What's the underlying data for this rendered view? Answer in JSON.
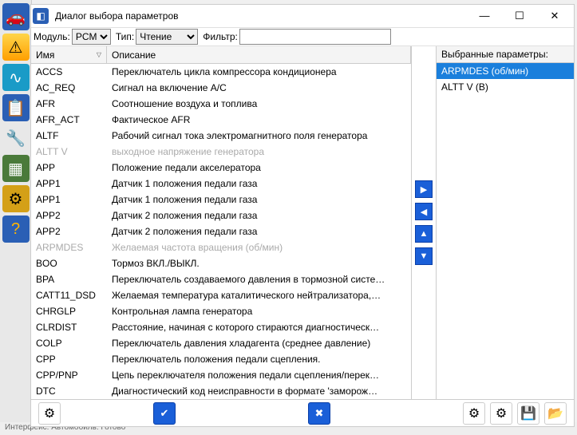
{
  "window": {
    "title": "Диалог выбора параметров",
    "min": "—",
    "max": "☐",
    "close": "✕"
  },
  "toolbar": {
    "module_label": "Модуль:",
    "module_value": "PCM",
    "type_label": "Тип:",
    "type_value": "Чтение",
    "filter_label": "Фильтр:",
    "filter_value": ""
  },
  "columns": {
    "name": "Имя",
    "desc": "Описание"
  },
  "rows": [
    {
      "name": "ACCS",
      "desc": "Переключатель цикла компрессора кондиционера",
      "disabled": false
    },
    {
      "name": "AC_REQ",
      "desc": "Сигнал на включение A/C",
      "disabled": false
    },
    {
      "name": "AFR",
      "desc": "Соотношение воздуха и топлива",
      "disabled": false
    },
    {
      "name": "AFR_ACT",
      "desc": "Фактическое AFR",
      "disabled": false
    },
    {
      "name": "ALTF",
      "desc": "Рабочий сигнал тока электромагнитного поля генератора",
      "disabled": false
    },
    {
      "name": "ALTT V",
      "desc": "выходное напряжение генератора",
      "disabled": true
    },
    {
      "name": "APP",
      "desc": "Положение педали акселератора",
      "disabled": false
    },
    {
      "name": "APP1",
      "desc": "Датчик 1 положения педали газа",
      "disabled": false
    },
    {
      "name": "APP1",
      "desc": "Датчик 1 положения педали газа",
      "disabled": false
    },
    {
      "name": "APP2",
      "desc": "Датчик 2 положения педали газа",
      "disabled": false
    },
    {
      "name": "APP2",
      "desc": "Датчик 2 положения педали газа",
      "disabled": false
    },
    {
      "name": "ARPMDES",
      "desc": "Желаемая частота вращения (об/мин)",
      "disabled": true
    },
    {
      "name": "BOO",
      "desc": "Тормоз ВКЛ./ВЫКЛ.",
      "disabled": false
    },
    {
      "name": "BPA",
      "desc": "Переключатель создаваемого давления в тормозной систе…",
      "disabled": false
    },
    {
      "name": "CATT11_DSD",
      "desc": "Желаемая температура каталитического нейтрализатора,…",
      "disabled": false
    },
    {
      "name": "CHRGLP",
      "desc": "Контрольная лампа генератора",
      "disabled": false
    },
    {
      "name": "CLRDIST",
      "desc": "Расстояние, начиная с которого стираются диагностическ…",
      "disabled": false
    },
    {
      "name": "COLP",
      "desc": "Переключатель давления хладагента (среднее давление)",
      "disabled": false
    },
    {
      "name": "CPP",
      "desc": "Переключатель положения педали сцепления.",
      "disabled": false
    },
    {
      "name": "CPP/PNP",
      "desc": "Цепь переключателя положения педали сцепления/перек…",
      "disabled": false
    },
    {
      "name": "DTC",
      "desc": "Диагностический код неисправности в формате 'заморож…",
      "disabled": false
    }
  ],
  "selected": {
    "title": "Выбранные параметры:",
    "items": [
      {
        "label": "ARPMDES (об/мин)",
        "selected": true
      },
      {
        "label": "ALTT V (В)",
        "selected": false
      }
    ]
  },
  "arrows": {
    "add": "▶",
    "remove": "◀",
    "up": "▲",
    "down": "▼"
  },
  "footer": {
    "gear": "⚙",
    "check": "✔",
    "x": "✖",
    "save": "💾",
    "open": "📂"
  },
  "status": "Интерфейс:    Автомобиль:    Готово"
}
